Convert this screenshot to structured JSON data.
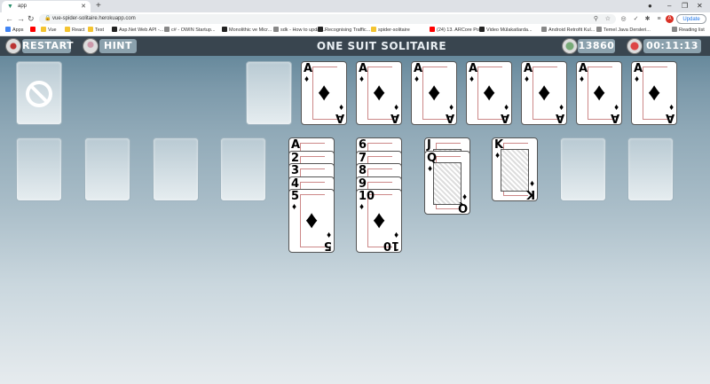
{
  "browser": {
    "tab_title": "app",
    "url": "vue-spider-solitaire.herokuapp.com",
    "update_label": "Update",
    "avatar_letter": "A",
    "bookmarks": [
      {
        "label": "Apps",
        "color": "#4285f4"
      },
      {
        "label": "",
        "color": "#ff0000"
      },
      {
        "label": "Vue",
        "color": "#f4c430"
      },
      {
        "label": "React",
        "color": "#f4c430"
      },
      {
        "label": "Test",
        "color": "#f4c430"
      },
      {
        "label": "Asp.Net Web API -...",
        "color": "#222222"
      },
      {
        "label": "c# - OWIN Startup...",
        "color": "#888888"
      },
      {
        "label": "Monolithic ve Micr...",
        "color": "#222222"
      },
      {
        "label": "sdk - How to updat...",
        "color": "#888888"
      },
      {
        "label": "Recognising Traffic...",
        "color": "#222222"
      },
      {
        "label": "spider-solitaire",
        "color": "#f4c430"
      },
      {
        "label": "(24) 13. ARCore Por...",
        "color": "#ff0000"
      },
      {
        "label": "Video Mülakatlarda...",
        "color": "#222222"
      },
      {
        "label": "Android Retrofit Kul...",
        "color": "#888888"
      },
      {
        "label": "Temel Java Dersleri...",
        "color": "#888888"
      },
      {
        "label": "Reading list",
        "color": "#888888"
      }
    ]
  },
  "game": {
    "restart_label": "RESTART",
    "hint_label": "HINT",
    "title": "ONE SUIT SOLITAIRE",
    "score": "13860",
    "timer": "00:11:13",
    "completed_foundations": [
      {
        "rank": "A",
        "suit": "♦"
      },
      {
        "rank": "A",
        "suit": "♦"
      },
      {
        "rank": "A",
        "suit": "♦"
      },
      {
        "rank": "A",
        "suit": "♦"
      },
      {
        "rank": "A",
        "suit": "♦"
      },
      {
        "rank": "A",
        "suit": "♦"
      },
      {
        "rank": "A",
        "suit": "♦"
      }
    ],
    "tableau": [
      {
        "column": 1,
        "cards": []
      },
      {
        "column": 2,
        "cards": []
      },
      {
        "column": 3,
        "cards": []
      },
      {
        "column": 4,
        "cards": []
      },
      {
        "column": 5,
        "cards": [
          "A",
          "2",
          "3",
          "4",
          "5"
        ],
        "suit": "♦"
      },
      {
        "column": 6,
        "cards": [
          "6",
          "7",
          "8",
          "9",
          "10"
        ],
        "suit": "♦"
      },
      {
        "column": 7,
        "cards": [
          "J",
          "Q"
        ],
        "suit": "♦"
      },
      {
        "column": 8,
        "cards": [
          "K"
        ],
        "suit": "♦"
      },
      {
        "column": 9,
        "cards": []
      },
      {
        "column": 10,
        "cards": []
      }
    ]
  }
}
